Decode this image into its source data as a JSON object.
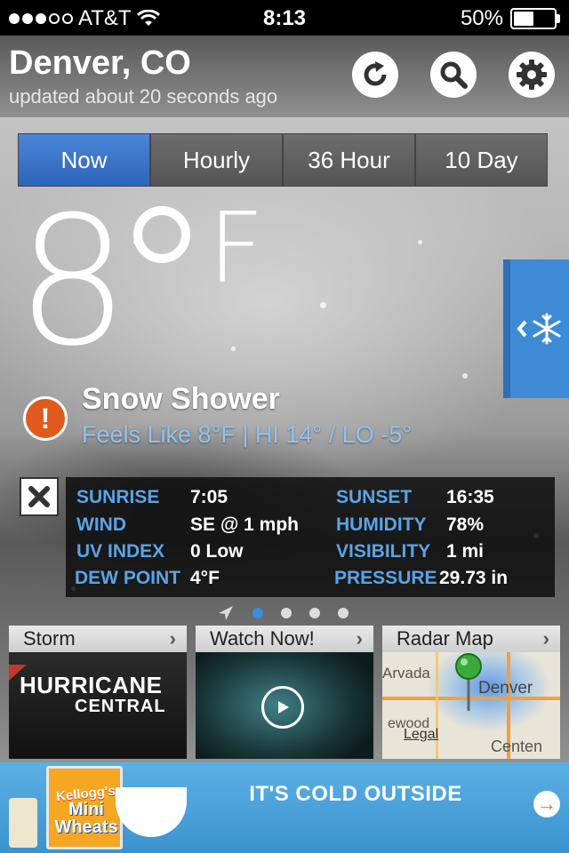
{
  "status_bar": {
    "carrier": "AT&T",
    "time": "8:13",
    "battery": "50%",
    "battery_level": 0.5
  },
  "header": {
    "city": "Denver, CO",
    "updated": "updated about 20 seconds ago",
    "icons": [
      "refresh-icon",
      "search-icon",
      "gear-icon"
    ]
  },
  "tabs": [
    {
      "label": "Now",
      "active": true
    },
    {
      "label": "Hourly",
      "active": false
    },
    {
      "label": "36 Hour",
      "active": false
    },
    {
      "label": "10 Day",
      "active": false
    }
  ],
  "current": {
    "temp": "8",
    "unit": "F",
    "condition": "Snow Shower",
    "feels": "Feels Like 8°F | HI 14° / LO -5°"
  },
  "details": {
    "sunrise_label": "SUNRISE",
    "sunrise": "7:05",
    "sunset_label": "SUNSET",
    "sunset": "16:35",
    "wind_label": "WIND",
    "wind": "SE @ 1 mph",
    "humidity_label": "HUMIDITY",
    "humidity": "78%",
    "uv_label": "UV INDEX",
    "uv": "0 Low",
    "visibility_label": "VISIBILITY",
    "visibility": "1 mi",
    "dew_label": "DEW POINT",
    "dew": "4°F",
    "pressure_label": "PRESSURE",
    "pressure": "29.73 in"
  },
  "pager": {
    "pages": 4,
    "current": 1
  },
  "cards": {
    "storm": {
      "title": "Storm",
      "line1": "HURRICANE",
      "line2": "CENTRAL"
    },
    "video": {
      "title": "Watch Now!"
    },
    "radar": {
      "title": "Radar Map",
      "city1": "Arvada",
      "city2": "Denver",
      "city3": "Centen",
      "legal": "Legal",
      "partial": "ewood"
    }
  },
  "ad": {
    "headline": "IT'S COLD OUTSIDE",
    "brand": "Kellogg's",
    "product": "Mini Wheats"
  },
  "colors": {
    "accent_blue": "#3c78d0",
    "detail_label": "#5aa3e6",
    "feels_like": "#8fc3f0",
    "alert": "#e05a1e",
    "side_tab": "#3e8ad6"
  }
}
